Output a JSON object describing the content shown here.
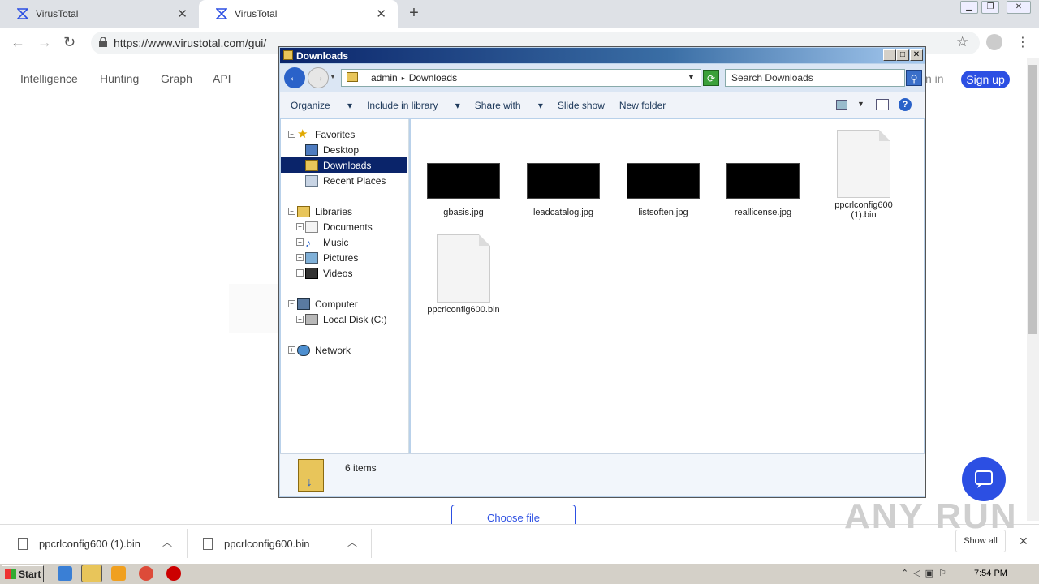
{
  "browser": {
    "tabs": [
      {
        "title": "VirusTotal"
      },
      {
        "title": "VirusTotal"
      }
    ],
    "url": "https://www.virustotal.com/gui/"
  },
  "page": {
    "nav": [
      "Intelligence",
      "Hunting",
      "Graph",
      "API"
    ],
    "signin": "n in",
    "signup": "Sign up",
    "choose_file": "Choose file",
    "brand_color": "#2c4fe3"
  },
  "explorer": {
    "title": "Downloads",
    "breadcrumb": [
      "admin",
      "Downloads"
    ],
    "search_placeholder": "Search Downloads",
    "commands": [
      "Organize",
      "Include in library",
      "Share with",
      "Slide show",
      "New folder"
    ],
    "tree": {
      "favorites": {
        "label": "Favorites",
        "items": [
          "Desktop",
          "Downloads",
          "Recent Places"
        ]
      },
      "libraries": {
        "label": "Libraries",
        "items": [
          "Documents",
          "Music",
          "Pictures",
          "Videos"
        ]
      },
      "computer": {
        "label": "Computer",
        "items": [
          "Local Disk (C:)"
        ]
      },
      "network": {
        "label": "Network"
      }
    },
    "files": [
      {
        "name": "gbasis.jpg",
        "kind": "image"
      },
      {
        "name": "leadcatalog.jpg",
        "kind": "image"
      },
      {
        "name": "listsoften.jpg",
        "kind": "image"
      },
      {
        "name": "reallicense.jpg",
        "kind": "image"
      },
      {
        "name": "ppcrlconfig600 (1).bin",
        "kind": "doc"
      },
      {
        "name": "ppcrlconfig600.bin",
        "kind": "doc"
      }
    ],
    "status": "6 items"
  },
  "downloads": {
    "items": [
      "ppcrlconfig600 (1).bin",
      "ppcrlconfig600.bin"
    ],
    "show_all": "Show all"
  },
  "taskbar": {
    "start": "Start",
    "clock": "7:54 PM"
  },
  "watermark": "ANY RUN"
}
